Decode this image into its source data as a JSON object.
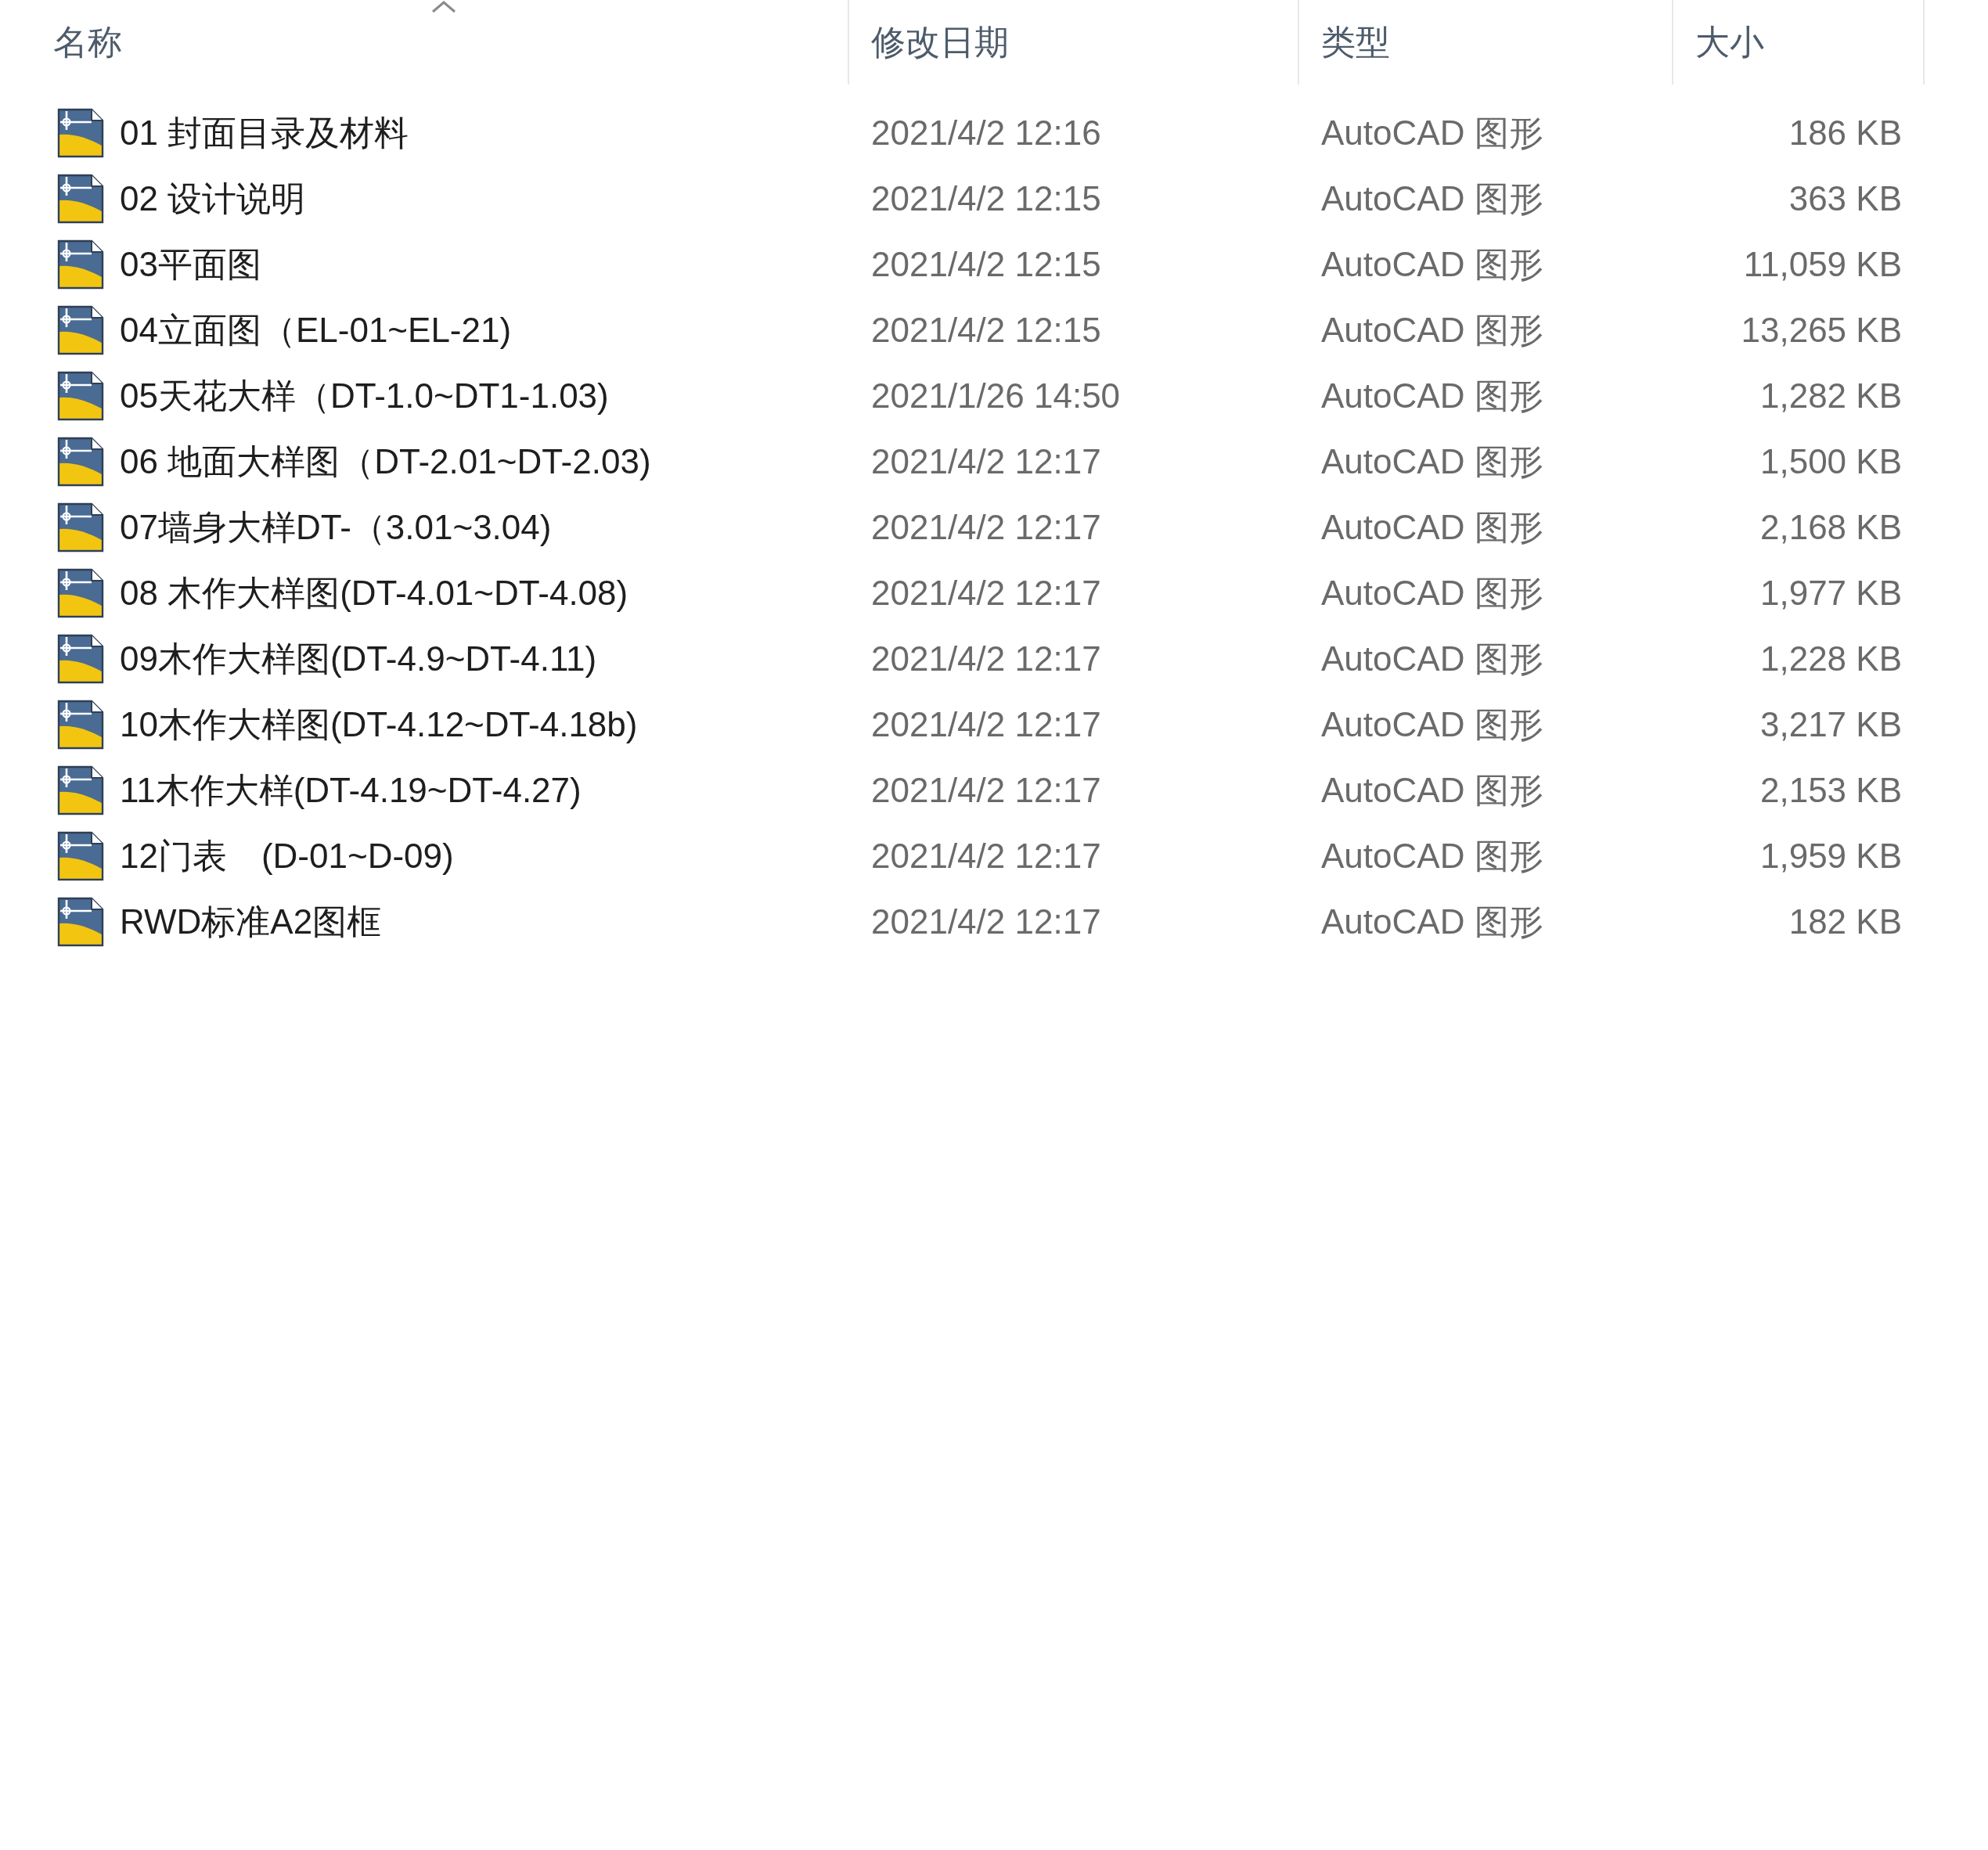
{
  "columns": [
    {
      "label": "名称",
      "sorted": true
    },
    {
      "label": "修改日期",
      "sorted": false
    },
    {
      "label": "类型",
      "sorted": false
    },
    {
      "label": "大小",
      "sorted": false
    }
  ],
  "files": [
    {
      "name": "01 封面目录及材料",
      "modified": "2021/4/2 12:16",
      "type": "AutoCAD 图形",
      "size": "186 KB"
    },
    {
      "name": "02 设计说明",
      "modified": "2021/4/2 12:15",
      "type": "AutoCAD 图形",
      "size": "363 KB"
    },
    {
      "name": "03平面图",
      "modified": "2021/4/2 12:15",
      "type": "AutoCAD 图形",
      "size": "11,059 KB"
    },
    {
      "name": "04立面图（EL-01~EL-21)",
      "modified": "2021/4/2 12:15",
      "type": "AutoCAD 图形",
      "size": "13,265 KB"
    },
    {
      "name": "05天花大样（DT-1.0~DT1-1.03)",
      "modified": "2021/1/26 14:50",
      "type": "AutoCAD 图形",
      "size": "1,282 KB"
    },
    {
      "name": "06 地面大样图（DT-2.01~DT-2.03)",
      "modified": "2021/4/2 12:17",
      "type": "AutoCAD 图形",
      "size": "1,500 KB"
    },
    {
      "name": "07墙身大样DT-（3.01~3.04)",
      "modified": "2021/4/2 12:17",
      "type": "AutoCAD 图形",
      "size": "2,168 KB"
    },
    {
      "name": "08 木作大样图(DT-4.01~DT-4.08)",
      "modified": "2021/4/2 12:17",
      "type": "AutoCAD 图形",
      "size": "1,977 KB"
    },
    {
      "name": "09木作大样图(DT-4.9~DT-4.11)",
      "modified": "2021/4/2 12:17",
      "type": "AutoCAD 图形",
      "size": "1,228 KB"
    },
    {
      "name": "10木作大样图(DT-4.12~DT-4.18b)",
      "modified": "2021/4/2 12:17",
      "type": "AutoCAD 图形",
      "size": "3,217 KB"
    },
    {
      "name": "11木作大样(DT-4.19~DT-4.27)",
      "modified": "2021/4/2 12:17",
      "type": "AutoCAD 图形",
      "size": "2,153 KB"
    },
    {
      "name": "12门表　(D-01~D-09)",
      "modified": "2021/4/2 12:17",
      "type": "AutoCAD 图形",
      "size": "1,959 KB"
    },
    {
      "name": "RWD标准A2图框",
      "modified": "2021/4/2 12:17",
      "type": "AutoCAD 图形",
      "size": "182 KB"
    }
  ]
}
